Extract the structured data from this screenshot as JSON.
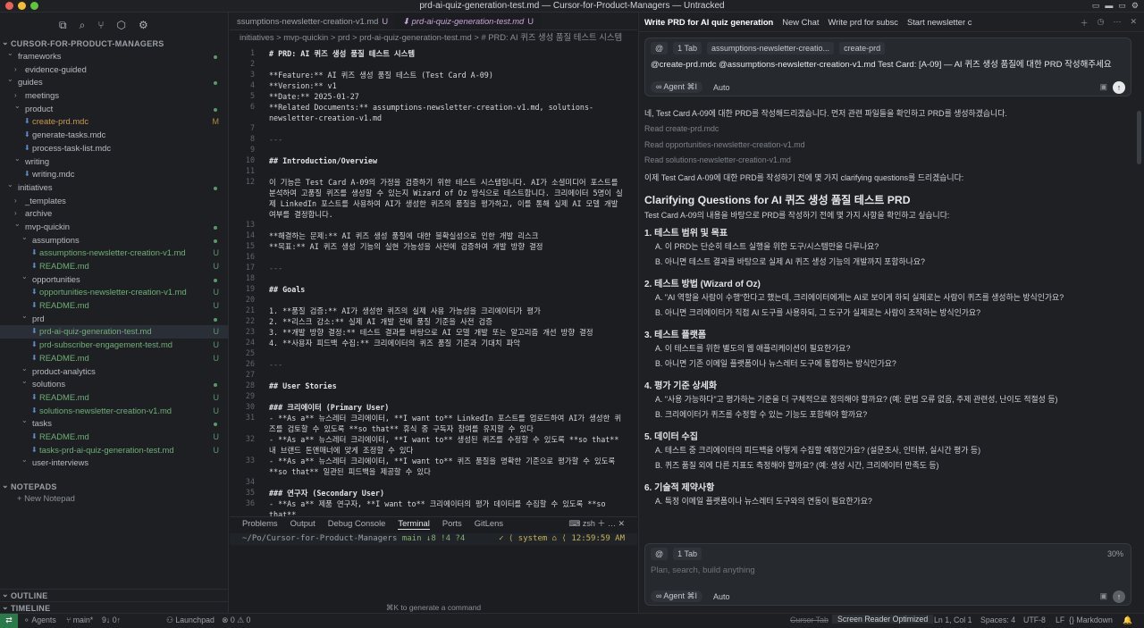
{
  "window": {
    "title": "prd-ai-quiz-generation-test.md — Cursor-for-Product-Managers — Untracked"
  },
  "colors": {
    "accent": "#c9a3d6",
    "git_untracked": "#5a9a6a",
    "git_modified": "#b58a3c",
    "remote": "#2a7a4a"
  },
  "sidebar": {
    "toolbar_icons": [
      "files-icon",
      "search-icon",
      "source-control-icon",
      "extensions-icon",
      "settings-icon"
    ],
    "workspace": "CURSOR-FOR-PRODUCT-MANAGERS",
    "items": [
      {
        "label": "frameworks",
        "depth": 1,
        "folder": true,
        "badge": "",
        "dot": true
      },
      {
        "label": "evidence-guided",
        "depth": 2,
        "folder": false,
        "badge": "",
        "dot": false
      },
      {
        "label": "guides",
        "depth": 1,
        "folder": true,
        "badge": "",
        "dot": true
      },
      {
        "label": "meetings",
        "depth": 2,
        "folder": false,
        "badge": "",
        "dot": false
      },
      {
        "label": "product",
        "depth": 2,
        "folder": true,
        "badge": "",
        "dot": true
      },
      {
        "label": "create-prd.mdc",
        "depth": 3,
        "folder": false,
        "badge": "M",
        "dot": false
      },
      {
        "label": "generate-tasks.mdc",
        "depth": 3,
        "folder": false,
        "badge": "",
        "dot": false
      },
      {
        "label": "process-task-list.mdc",
        "depth": 3,
        "folder": false,
        "badge": "",
        "dot": false
      },
      {
        "label": "writing",
        "depth": 2,
        "folder": true,
        "badge": "",
        "dot": false
      },
      {
        "label": "writing.mdc",
        "depth": 3,
        "folder": false,
        "badge": "",
        "dot": false
      },
      {
        "label": "initiatives",
        "depth": 1,
        "folder": true,
        "badge": "",
        "dot": true
      },
      {
        "label": "_templates",
        "depth": 2,
        "folder": false,
        "badge": "",
        "dot": false
      },
      {
        "label": "archive",
        "depth": 2,
        "folder": false,
        "badge": "",
        "dot": false
      },
      {
        "label": "mvp-quickin",
        "depth": 2,
        "folder": true,
        "badge": "",
        "dot": true
      },
      {
        "label": "assumptions",
        "depth": 3,
        "folder": true,
        "badge": "",
        "dot": true
      },
      {
        "label": "assumptions-newsletter-creation-v1.md",
        "depth": 4,
        "folder": false,
        "badge": "U",
        "dot": false
      },
      {
        "label": "README.md",
        "depth": 4,
        "folder": false,
        "badge": "U",
        "dot": false
      },
      {
        "label": "opportunities",
        "depth": 3,
        "folder": true,
        "badge": "",
        "dot": true
      },
      {
        "label": "opportunities-newsletter-creation-v1.md",
        "depth": 4,
        "folder": false,
        "badge": "U",
        "dot": false
      },
      {
        "label": "README.md",
        "depth": 4,
        "folder": false,
        "badge": "U",
        "dot": false
      },
      {
        "label": "prd",
        "depth": 3,
        "folder": true,
        "badge": "",
        "dot": true
      },
      {
        "label": "prd-ai-quiz-generation-test.md",
        "depth": 4,
        "folder": false,
        "badge": "U",
        "dot": false,
        "selected": true
      },
      {
        "label": "prd-subscriber-engagement-test.md",
        "depth": 4,
        "folder": false,
        "badge": "U",
        "dot": false
      },
      {
        "label": "README.md",
        "depth": 4,
        "folder": false,
        "badge": "U",
        "dot": false
      },
      {
        "label": "product-analytics",
        "depth": 3,
        "folder": true,
        "badge": "",
        "dot": false
      },
      {
        "label": "solutions",
        "depth": 3,
        "folder": true,
        "badge": "",
        "dot": true
      },
      {
        "label": "README.md",
        "depth": 4,
        "folder": false,
        "badge": "U",
        "dot": false
      },
      {
        "label": "solutions-newsletter-creation-v1.md",
        "depth": 4,
        "folder": false,
        "badge": "U",
        "dot": false
      },
      {
        "label": "tasks",
        "depth": 3,
        "folder": true,
        "badge": "",
        "dot": true
      },
      {
        "label": "README.md",
        "depth": 4,
        "folder": false,
        "badge": "U",
        "dot": false
      },
      {
        "label": "tasks-prd-ai-quiz-generation-test.md",
        "depth": 4,
        "folder": false,
        "badge": "U",
        "dot": false
      },
      {
        "label": "user-interviews",
        "depth": 3,
        "folder": true,
        "badge": "",
        "dot": false
      }
    ],
    "notepads_header": "NOTEPADS",
    "new_notepad": "New Notepad",
    "outline": "OUTLINE",
    "timeline": "TIMELINE"
  },
  "editor": {
    "tabs": [
      {
        "label": "ssumptions-newsletter-creation-v1.md",
        "badge": "U",
        "active": false
      },
      {
        "label": "prd-ai-quiz-generation-test.md",
        "badge": "U",
        "active": true
      }
    ],
    "breadcrumb": "initiatives  >  mvp-quickin  >  prd  >  prd-ai-quiz-generation-test.md  >  # PRD: AI 퀴즈 생성 품질 테스트 시스템",
    "lines": [
      {
        "n": "1",
        "t": "# PRD: AI 퀴즈 생성 품질 테스트 시스템",
        "c": "hd"
      },
      {
        "n": "2",
        "t": "",
        "c": ""
      },
      {
        "n": "3",
        "t": "**Feature:** AI 퀴즈 생성 품질 테스트 (Test Card A-09)",
        "c": ""
      },
      {
        "n": "4",
        "t": "**Version:** v1",
        "c": ""
      },
      {
        "n": "5",
        "t": "**Date:** 2025-01-27",
        "c": ""
      },
      {
        "n": "6",
        "t": "**Related Documents:** assumptions-newsletter-creation-v1.md, solutions-newsletter-creation-v1.md",
        "c": ""
      },
      {
        "n": "7",
        "t": "",
        "c": ""
      },
      {
        "n": "8",
        "t": "---",
        "c": "mut"
      },
      {
        "n": "9",
        "t": "",
        "c": ""
      },
      {
        "n": "10",
        "t": "## Introduction/Overview",
        "c": "hd"
      },
      {
        "n": "11",
        "t": "",
        "c": ""
      },
      {
        "n": "12",
        "t": "이 기능은 Test Card A-09의 가정을 검증하기 위한 테스트 시스템입니다. AI가 소셜미디어 포스트를 분석하여 고품질 퀴즈를 생성할 수 있는지 Wizard of Oz 방식으로 테스트합니다. 크리에이터 5명이 실제 LinkedIn 포스트를 사용하여 AI가 생성한 퀴즈의 품질을 평가하고, 이를 통해 실제 AI 모델 개발 여부를 결정합니다.",
        "c": ""
      },
      {
        "n": "13",
        "t": "",
        "c": ""
      },
      {
        "n": "14",
        "t": "**해결하는 문제:** AI 퀴즈 생성 품질에 대한 불확실성으로 인한 개발 리스크",
        "c": ""
      },
      {
        "n": "15",
        "t": "**목표:** AI 퀴즈 생성 기능의 실현 가능성을 사전에 검증하여 개발 방향 결정",
        "c": ""
      },
      {
        "n": "16",
        "t": "",
        "c": ""
      },
      {
        "n": "17",
        "t": "---",
        "c": "mut"
      },
      {
        "n": "18",
        "t": "",
        "c": ""
      },
      {
        "n": "19",
        "t": "## Goals",
        "c": "hd"
      },
      {
        "n": "20",
        "t": "",
        "c": ""
      },
      {
        "n": "21",
        "t": "1. **품질 검증:** AI가 생성한 퀴즈의 실제 사용 가능성을 크리에이터가 평가",
        "c": ""
      },
      {
        "n": "22",
        "t": "2. **리스크 감소:** 실제 AI 개발 전에 품질 기준을 사전 검증",
        "c": ""
      },
      {
        "n": "23",
        "t": "3. **개발 방향 결정:** 테스트 결과를 바탕으로 AI 모델 개발 또는 알고리즘 개선 방향 결정",
        "c": ""
      },
      {
        "n": "24",
        "t": "4. **사용자 피드백 수집:** 크리에이터의 퀴즈 품질 기준과 기대치 파악",
        "c": ""
      },
      {
        "n": "25",
        "t": "",
        "c": ""
      },
      {
        "n": "26",
        "t": "---",
        "c": "mut"
      },
      {
        "n": "27",
        "t": "",
        "c": ""
      },
      {
        "n": "28",
        "t": "## User Stories",
        "c": "hd"
      },
      {
        "n": "29",
        "t": "",
        "c": ""
      },
      {
        "n": "30",
        "t": "### 크리에이터 (Primary User)",
        "c": "hd"
      },
      {
        "n": "31",
        "t": "- **As a** 뉴스레터 크리에이터, **I want to** LinkedIn 포스트를 업로드하여 AI가 생성한 퀴즈를 검토할 수 있도록 **so that** 휴식 중 구독자 참여를 유지할 수 있다",
        "c": ""
      },
      {
        "n": "32",
        "t": "- **As a** 뉴스레터 크리에이터, **I want to** 생성된 퀴즈를 수정할 수 있도록 **so that** 내 브랜드 톤앤매너에 맞게 조정할 수 있다",
        "c": ""
      },
      {
        "n": "33",
        "t": "- **As a** 뉴스레터 크리에이터, **I want to** 퀴즈 품질을 명확한 기준으로 평가할 수 있도록 **so that** 일관된 피드백을 제공할 수 있다",
        "c": ""
      },
      {
        "n": "34",
        "t": "",
        "c": ""
      },
      {
        "n": "35",
        "t": "### 연구자 (Secondary User)",
        "c": "hd"
      },
      {
        "n": "36",
        "t": "- **As a** 제품 연구자, **I want to** 크리에이터의 평가 데이터를 수집할 수 있도록 **so that**",
        "c": ""
      }
    ]
  },
  "panel": {
    "tabs": [
      "Problems",
      "Output",
      "Debug Console",
      "Terminal",
      "Ports",
      "GitLens"
    ],
    "active_tab": "Terminal",
    "shell": "zsh",
    "prompt_path": "~/Po/Cursor-for-Product-Managers",
    "branch": "main ↓8 !4 ?4",
    "right_status": "✓ ⟨ system ⌂ ⟨ 12:59:59 AM",
    "hint": "⌘K to generate a command"
  },
  "chat": {
    "tabs": [
      "Write PRD for AI quiz generation",
      "New Chat",
      "Write prd for subsc",
      "Start newsletter c"
    ],
    "chips": [
      "@",
      "1 Tab",
      "assumptions-newsletter-creatio...",
      "create-prd"
    ],
    "prompt": "@create-prd.mdc  @assumptions-newsletter-creation-v1.md  Test Card: [A-09] — AI 퀴즈 생성 품질에 대한 PRD 작성해주세요",
    "agent_label": "Agent ⌘I",
    "auto_label": "Auto",
    "response": [
      {
        "t": "네, Test Card A-09에 대한 PRD를 작성해드리겠습니다. 먼저 관련 파일들을 확인하고 PRD를 생성하겠습니다.",
        "c": ""
      },
      {
        "t": "Read create-prd.mdc",
        "c": "muted"
      },
      {
        "t": "Read opportunities-newsletter-creation-v1.md",
        "c": "muted"
      },
      {
        "t": "Read solutions-newsletter-creation-v1.md",
        "c": "muted"
      },
      {
        "t": "이제 Test Card A-09에 대한 PRD를 작성하기 전에 몇 가지 clarifying questions를 드리겠습니다:",
        "c": ""
      },
      {
        "t": "Clarifying Questions for AI 퀴즈 생성 품질 테스트 PRD",
        "c": "h2"
      },
      {
        "t": "Test Card A-09의 내용을 바탕으로 PRD를 작성하기 전에 몇 가지 사항을 확인하고 싶습니다:",
        "c": ""
      },
      {
        "t": "1. 테스트 범위 및 목표",
        "c": "h3"
      },
      {
        "t": "A. 이 PRD는 단순히 테스트 실행을 위한 도구/시스템만을 다루나요?",
        "c": "li"
      },
      {
        "t": "B. 아니면 테스트 결과를 바탕으로 실제 AI 퀴즈 생성 기능의 개발까지 포함하나요?",
        "c": "li"
      },
      {
        "t": "2. 테스트 방법 (Wizard of Oz)",
        "c": "h3"
      },
      {
        "t": "A. \"AI 역할을 사람이 수행\"한다고 했는데, 크리에이터에게는 AI로 보이게 하되 실제로는 사람이 퀴즈를 생성하는 방식인가요?",
        "c": "li"
      },
      {
        "t": "B. 아니면 크리에이터가 직접 AI 도구를 사용하되, 그 도구가 실제로는 사람이 조작하는 방식인가요?",
        "c": "li"
      },
      {
        "t": "3. 테스트 플랫폼",
        "c": "h3"
      },
      {
        "t": "A. 이 테스트를 위한 별도의 웹 애플리케이션이 필요한가요?",
        "c": "li"
      },
      {
        "t": "B. 아니면 기존 이메일 플랫폼이나 뉴스레터 도구에 통합하는 방식인가요?",
        "c": "li"
      },
      {
        "t": "4. 평가 기준 상세화",
        "c": "h3"
      },
      {
        "t": "A. \"사용 가능하다\"고 평가하는 기준을 더 구체적으로 정의해야 할까요? (예: 문법 오류 없음, 주제 관련성, 난이도 적절성 등)",
        "c": "li"
      },
      {
        "t": "B. 크리에이터가 퀴즈를 수정할 수 있는 기능도 포함해야 할까요?",
        "c": "li"
      },
      {
        "t": "5. 데이터 수집",
        "c": "h3"
      },
      {
        "t": "A. 테스트 중 크리에이터의 피드백을 어떻게 수집할 예정인가요? (설문조사, 인터뷰, 실시간 평가 등)",
        "c": "li"
      },
      {
        "t": "B. 퀴즈 품질 외에 다른 지표도 측정해야 할까요? (예: 생성 시간, 크리에이터 만족도 등)",
        "c": "li"
      },
      {
        "t": "6. 기술적 제약사항",
        "c": "h3"
      },
      {
        "t": "A. 특정 이메일 플랫폼이나 뉴스레터 도구와의 연동이 필요한가요?",
        "c": "li"
      }
    ],
    "composer": {
      "chip": "1 Tab",
      "placeholder": "Plan, search, build anything",
      "percent": "30%"
    }
  },
  "statusbar": {
    "agents": "Agents",
    "branch": "main*",
    "sync": "9↓ 0↑",
    "launchpad": "Launchpad",
    "problems": "⊗ 0 ⚠ 0",
    "cursor_tab": "Cursor Tab",
    "screen_reader": "Screen Reader Optimized",
    "position": "Ln 1, Col 1",
    "spaces": "Spaces: 4",
    "encoding": "UTF-8",
    "eol": "LF",
    "language": "Markdown"
  }
}
